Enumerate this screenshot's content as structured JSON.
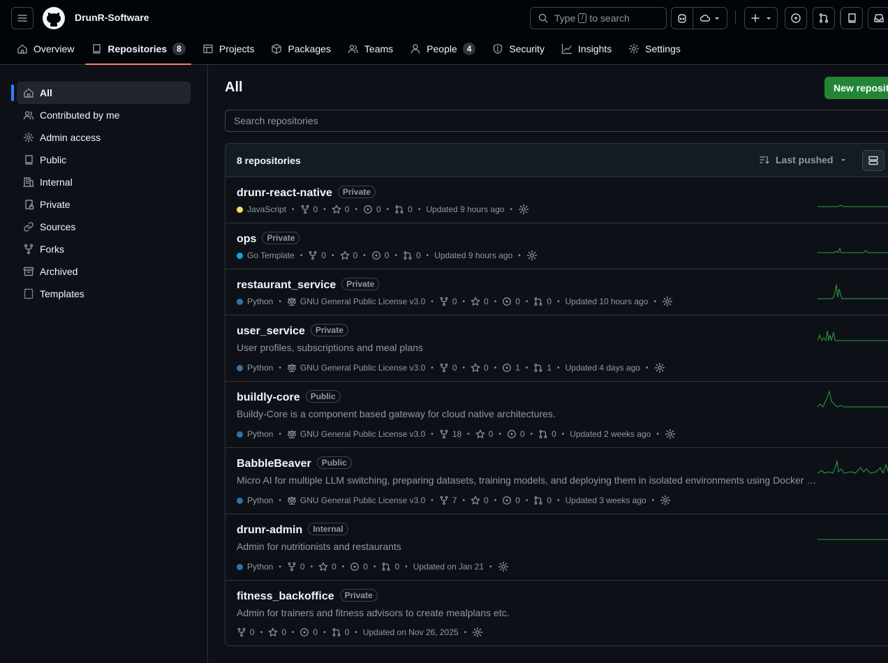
{
  "header": {
    "org_name": "DrunR-Software",
    "search_prefix": "Type",
    "search_key": "/",
    "search_suffix": "to search"
  },
  "tabs": [
    {
      "label": "Overview",
      "icon": "home-icon"
    },
    {
      "label": "Repositories",
      "count": "8",
      "icon": "repo-icon"
    },
    {
      "label": "Projects",
      "icon": "table-icon"
    },
    {
      "label": "Packages",
      "icon": "package-icon"
    },
    {
      "label": "Teams",
      "icon": "people-icon"
    },
    {
      "label": "People",
      "count": "4",
      "icon": "person-icon"
    },
    {
      "label": "Security",
      "icon": "shield-icon"
    },
    {
      "label": "Insights",
      "icon": "graph-icon"
    },
    {
      "label": "Settings",
      "icon": "gear-icon"
    }
  ],
  "sidebar": {
    "items": [
      {
        "label": "All",
        "icon": "home-icon"
      },
      {
        "label": "Contributed by me",
        "icon": "people-icon"
      },
      {
        "label": "Admin access",
        "icon": "gear-icon"
      },
      {
        "label": "Public",
        "icon": "repo-icon"
      },
      {
        "label": "Internal",
        "icon": "organization-icon"
      },
      {
        "label": "Private",
        "icon": "repo-locked-icon"
      },
      {
        "label": "Sources",
        "icon": "link-icon"
      },
      {
        "label": "Forks",
        "icon": "fork-icon"
      },
      {
        "label": "Archived",
        "icon": "archive-icon"
      },
      {
        "label": "Templates",
        "icon": "repo-template-icon"
      }
    ]
  },
  "main": {
    "title": "All",
    "new_repo_label": "New repository",
    "search_placeholder": "Search repositories",
    "repo_count_label": "8 repositories",
    "sort_label": "Last pushed"
  },
  "colors": {
    "JavaScript": "#f1e05a",
    "Go Template": "#00add8",
    "Python": "#3572a5",
    "accent_green": "#238636",
    "active_tab_underline": "#f78166"
  },
  "repos": [
    {
      "name": "drunr-react-native",
      "visibility": "Private",
      "description": "",
      "language": "JavaScript",
      "license": "",
      "forks": "0",
      "stars": "0",
      "issues": "0",
      "prs": "0",
      "updated": "Updated 9 hours ago"
    },
    {
      "name": "ops",
      "visibility": "Private",
      "description": "",
      "language": "Go Template",
      "license": "",
      "forks": "0",
      "stars": "0",
      "issues": "0",
      "prs": "0",
      "updated": "Updated 9 hours ago"
    },
    {
      "name": "restaurant_service",
      "visibility": "Private",
      "description": "",
      "language": "Python",
      "license": "GNU General Public License v3.0",
      "forks": "0",
      "stars": "0",
      "issues": "0",
      "prs": "0",
      "updated": "Updated 10 hours ago"
    },
    {
      "name": "user_service",
      "visibility": "Private",
      "description": "User profiles, subscriptions and meal plans",
      "language": "Python",
      "license": "GNU General Public License v3.0",
      "forks": "0",
      "stars": "0",
      "issues": "1",
      "prs": "1",
      "updated": "Updated 4 days ago"
    },
    {
      "name": "buildly-core",
      "visibility": "Public",
      "description": "Buildy-Core is a component based gateway for cloud native architectures.",
      "language": "Python",
      "license": "GNU General Public License v3.0",
      "forks": "18",
      "stars": "0",
      "issues": "0",
      "prs": "0",
      "updated": "Updated 2 weeks ago"
    },
    {
      "name": "BabbleBeaver",
      "visibility": "Public",
      "description": "Micro AI for multiple LLM switching, preparing datasets, training models, and deploying them in isolated environments using Docker containers.",
      "language": "Python",
      "license": "GNU General Public License v3.0",
      "forks": "7",
      "stars": "0",
      "issues": "0",
      "prs": "0",
      "updated": "Updated 3 weeks ago"
    },
    {
      "name": "drunr-admin",
      "visibility": "Internal",
      "description": "Admin for nutritionists and restaurants",
      "language": "Python",
      "license": "",
      "forks": "0",
      "stars": "0",
      "issues": "0",
      "prs": "0",
      "updated": "Updated on Jan 21"
    },
    {
      "name": "fitness_backoffice",
      "visibility": "Private",
      "description": "Admin for trainers and fitness advisors to create mealplans etc.",
      "language": "",
      "license": "",
      "forks": "0",
      "stars": "0",
      "issues": "0",
      "prs": "0",
      "updated": "Updated on Nov 26, 2025"
    }
  ]
}
